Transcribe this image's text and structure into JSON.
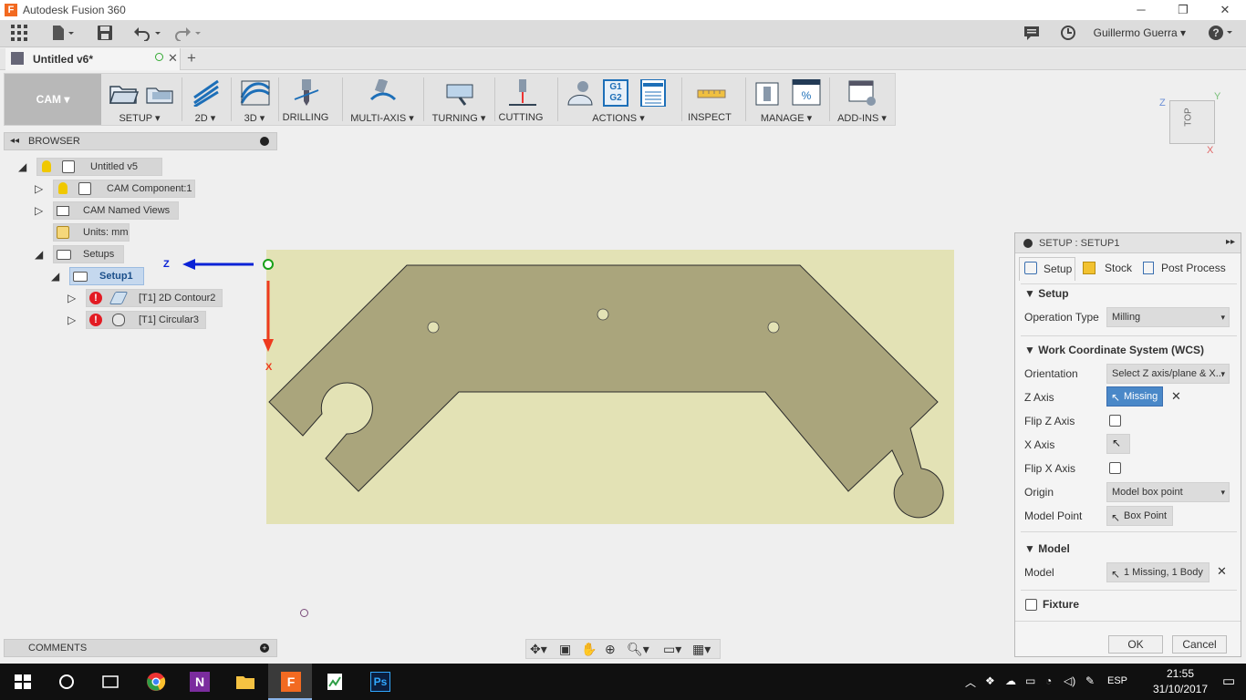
{
  "window": {
    "app_icon": "F",
    "title": "Autodesk Fusion 360",
    "minimize": "─",
    "maximize": "❐",
    "close": "✕"
  },
  "qab": {
    "grid_icon": "app-grid-icon",
    "user": "Guillermo Guerra ▾",
    "help": "?"
  },
  "doc_tab": {
    "name": "Untitled v6*",
    "close": "✕",
    "new_tab": "+"
  },
  "toolbar": {
    "workspace": "CAM ▾",
    "groups": [
      {
        "label": "SETUP ▾"
      },
      {
        "label": "2D ▾"
      },
      {
        "label": "3D ▾"
      },
      {
        "label": "DRILLING"
      },
      {
        "label": "MULTI-AXIS ▾"
      },
      {
        "label": "TURNING ▾"
      },
      {
        "label": "CUTTING"
      },
      {
        "label": "ACTIONS ▾"
      },
      {
        "label": "INSPECT"
      },
      {
        "label": "MANAGE ▾"
      },
      {
        "label": "ADD-INS ▾"
      }
    ],
    "g1g2": [
      "G1",
      "G2"
    ]
  },
  "browser": {
    "title": "BROWSER",
    "collapse": "◂◂",
    "nodes": {
      "root": "Untitled v5",
      "component": "CAM Component:1",
      "named_views": "CAM Named Views",
      "units": "Units: mm",
      "setups": "Setups",
      "setup1": "Setup1",
      "op1": "[T1] 2D Contour2",
      "op2": "[T1] Circular3"
    },
    "expand_glyph": "▷",
    "collapse_glyph": "◢"
  },
  "comments": {
    "title": "COMMENTS",
    "add": "+"
  },
  "viewport": {
    "axis_z": "Z",
    "axis_x": "X",
    "axis_y": "Y",
    "viewcube_face": "TOP",
    "viewcube_z": "Z",
    "viewcube_y": "Y",
    "viewcube_x": "X",
    "stock_color": "#e3e2b5",
    "part_color": "#aaa57c"
  },
  "dialog": {
    "title": "SETUP : SETUP1",
    "expand": "▸▸",
    "tabs": {
      "setup": "Setup",
      "stock": "Stock",
      "post": "Post Process"
    },
    "sections": {
      "setup": "Setup",
      "wcs": "Work Coordinate System (WCS)",
      "model": "Model",
      "fixture": "Fixture"
    },
    "fields": {
      "operation_type_label": "Operation Type",
      "operation_type_value": "Milling",
      "orientation_label": "Orientation",
      "orientation_value": "Select Z axis/plane & X...",
      "z_axis_label": "Z Axis",
      "z_axis_value": "Missing",
      "flip_z_label": "Flip Z Axis",
      "x_axis_label": "X Axis",
      "flip_x_label": "Flip X Axis",
      "origin_label": "Origin",
      "origin_value": "Model box point",
      "model_point_label": "Model Point",
      "model_point_value": "Box Point",
      "model_label": "Model",
      "model_value": "1 Missing, 1 Body"
    },
    "clear": "✕",
    "ok": "OK",
    "cancel": "Cancel",
    "caret": "▾"
  },
  "navbar": {
    "icons": [
      "orbit-icon",
      "look-at-icon",
      "pan-icon",
      "zoom-window-icon",
      "zoom-icon",
      "display-icon",
      "grid-icon"
    ]
  },
  "taskbar": {
    "apps": [
      "windows-start-icon",
      "cortana-icon",
      "task-view-icon",
      "chrome-icon",
      "onenote-icon",
      "file-explorer-icon",
      "fusion-icon",
      "cam-editor-icon",
      "photoshop-icon"
    ],
    "lang": "ESP",
    "time": "21:55",
    "date": "31/10/2017",
    "onenote_letter": "N",
    "ps_letters": "Ps"
  }
}
